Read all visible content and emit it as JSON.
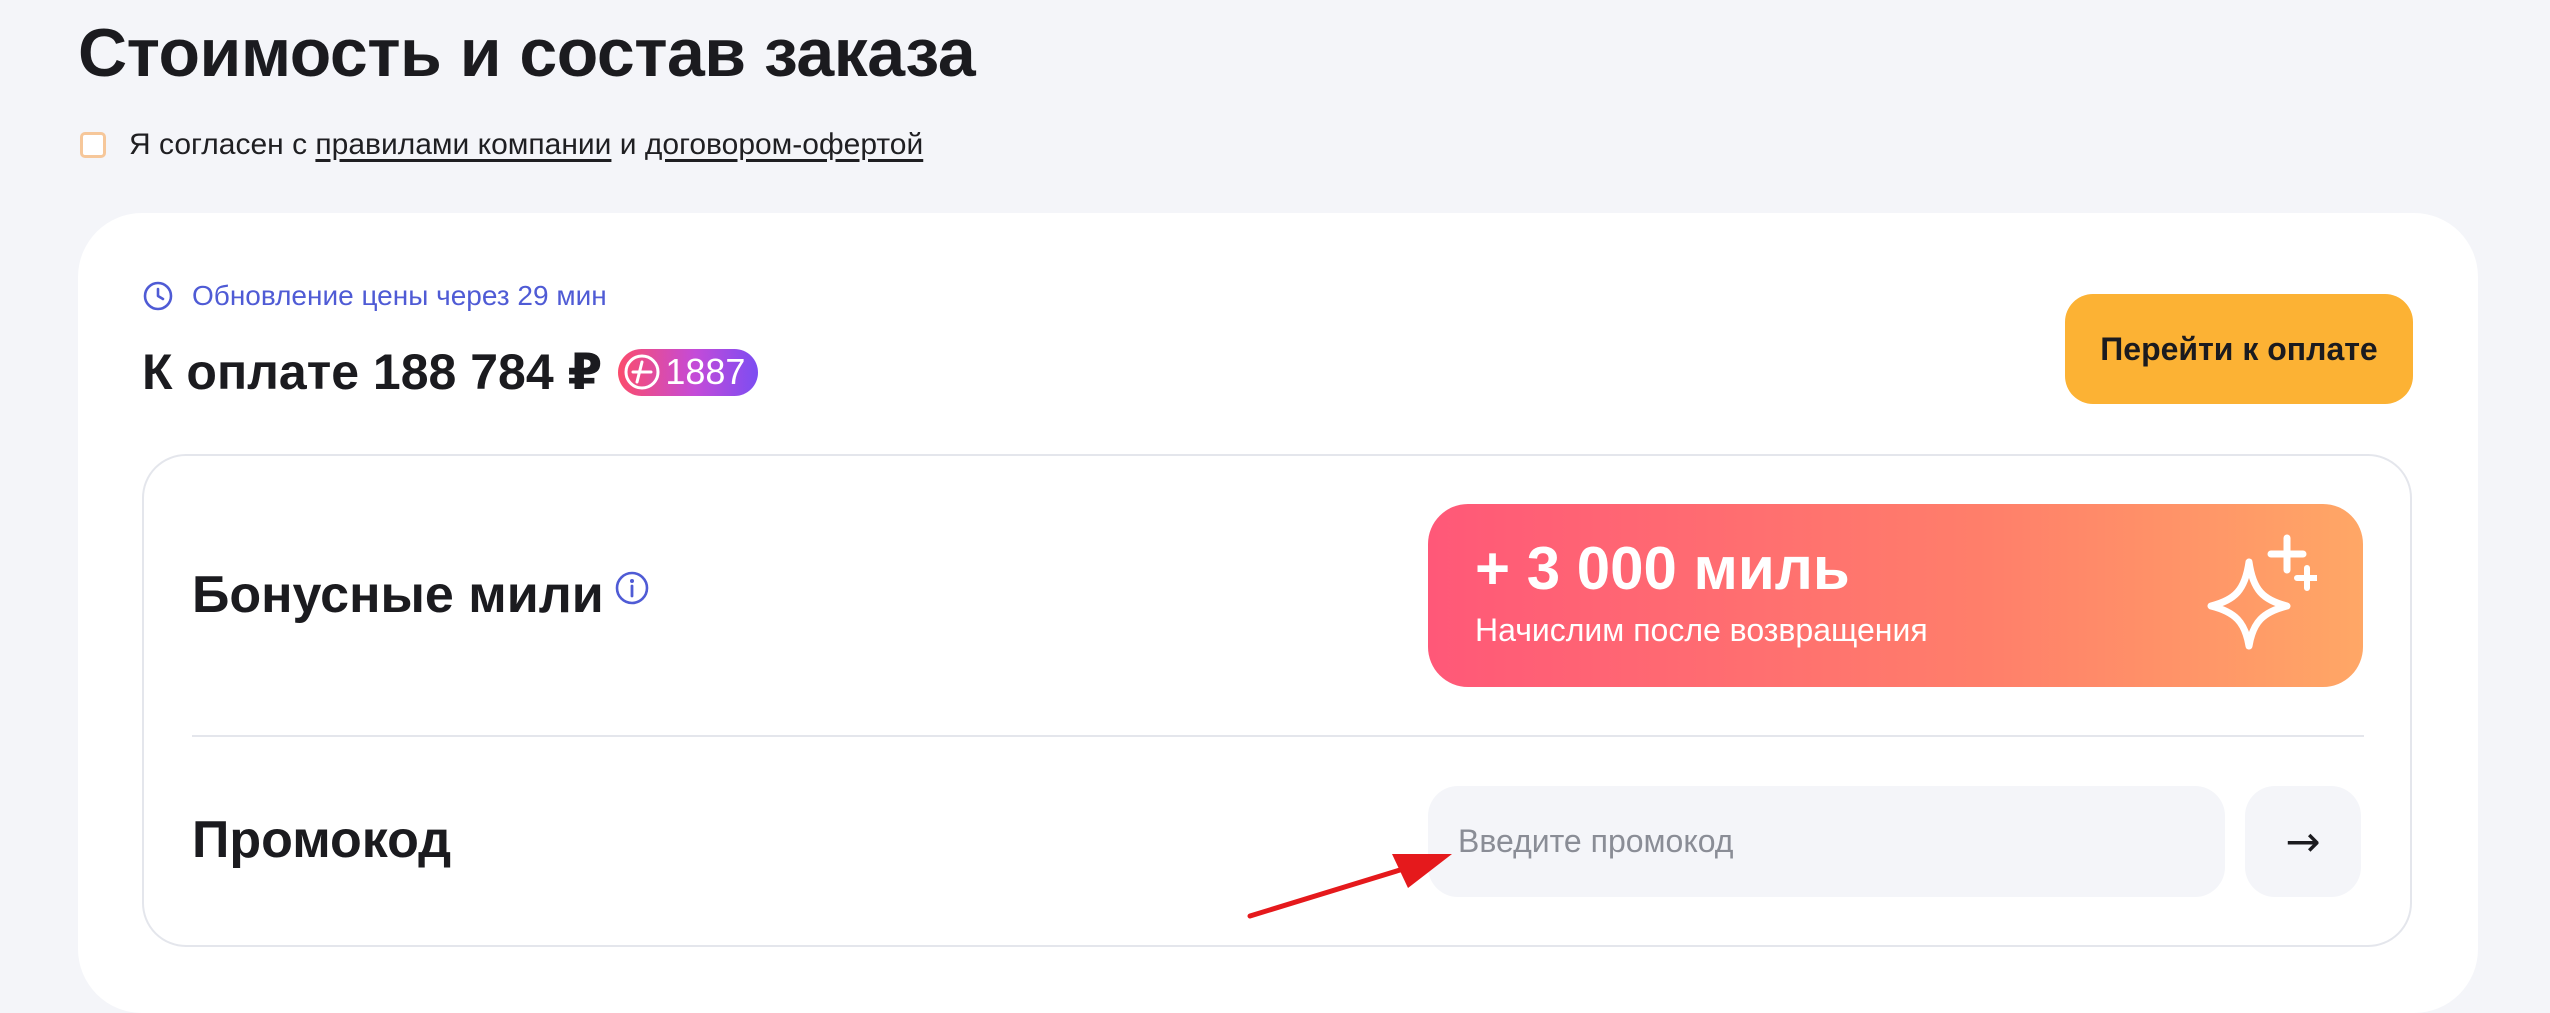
{
  "page": {
    "title": "Стоимость и состав заказа"
  },
  "agreement": {
    "prefix": "Я согласен с ",
    "rules_link": "правилами компании",
    "middle": " и ",
    "offer_link": "договором-офертой"
  },
  "summary": {
    "price_update": "Обновление цены через 29 мин",
    "pay_label": "К оплате 188 784 ₽",
    "badge_value": "1887",
    "pay_button": "Перейти к оплате"
  },
  "bonus": {
    "title": "Бонусные мили",
    "amount": "+ 3 000 миль",
    "note": "Начислим после возвращения"
  },
  "promo": {
    "title": "Промокод",
    "placeholder": "Введите промокод",
    "value": "",
    "submit_label": "→"
  },
  "colors": {
    "accent_button": "#fcb234",
    "link_blue": "#4f5bd5",
    "annotation_red": "#e5191c",
    "banner_gradient_start": "#ff5878",
    "banner_gradient_end": "#ffa766"
  },
  "icons": [
    "clock-icon",
    "plus-badge-icon",
    "info-icon",
    "sparkle-icon",
    "arrow-right-icon",
    "annotation-arrow"
  ]
}
